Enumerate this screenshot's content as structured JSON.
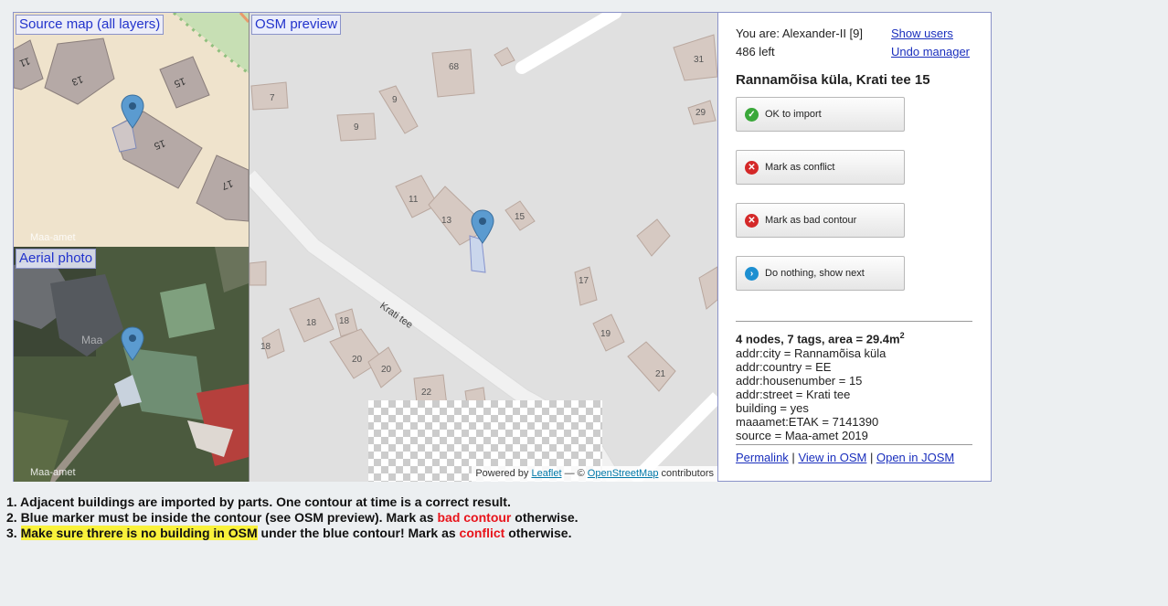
{
  "panes": {
    "source_label": "Source map (all layers)",
    "aerial_label": "Aerial photo",
    "osm_label": "OSM preview",
    "source_credit": "Maa-amet",
    "aerial_credit": "Maa-amet",
    "aerial_watermark": "Maa"
  },
  "source_map": {
    "house_numbers": [
      "11",
      "13",
      "15",
      "15",
      "17"
    ]
  },
  "osm_map": {
    "street_name": "Krati tee",
    "house_numbers": [
      "68",
      "31",
      "7",
      "9",
      "9",
      "29",
      "11",
      "13",
      "15",
      "17",
      "18",
      "18",
      "18",
      "19",
      "20",
      "20",
      "21",
      "22"
    ]
  },
  "attribution": {
    "powered_by": "Powered by",
    "leaflet": "Leaflet",
    "dash": "— ©",
    "osm": "OpenStreetMap",
    "contributors": "contributors"
  },
  "user": {
    "you_are": "You are: Alexander-II [9]",
    "left": "486 left",
    "show_users": "Show users",
    "undo_manager": "Undo manager"
  },
  "address": "Rannamõisa küla, Krati tee 15",
  "buttons": {
    "ok": "OK to import",
    "conflict": "Mark as conflict",
    "bad_contour": "Mark as bad contour",
    "nothing": "Do nothing, show next"
  },
  "summary": {
    "nodes_tags": "4 nodes, 7 tags",
    "area_prefix": ", area = 29.4m",
    "area_sup": "2"
  },
  "tags": [
    "addr:city = Rannamõisa küla",
    "addr:country = EE",
    "addr:housenumber = 15",
    "addr:street = Krati tee",
    "building = yes",
    "maaamet:ETAK = 7141390",
    "source = Maa-amet 2019"
  ],
  "links": {
    "permalink": "Permalink",
    "sep": "|",
    "view_osm": "View in OSM",
    "open_josm": "Open in JOSM"
  },
  "notes": {
    "n1": "1. Adjacent buildings are imported by parts. One contour at time is a correct result.",
    "n2_a": "2. Blue marker must be inside the contour (see OSM preview). Mark as ",
    "n2_red": "bad contour",
    "n2_b": " otherwise.",
    "n3_a": "3. ",
    "n3_hl": "Make sure threre is no building in OSM",
    "n3_b": " under the blue contour! Mark as ",
    "n3_red": "conflict",
    "n3_c": " otherwise."
  },
  "colors": {
    "ok": "#3aa83a",
    "conflict": "#d42828",
    "nothing": "#1d8fd1",
    "link": "#1a2fbd",
    "warn_red": "#e8141b",
    "highlight": "#f9f23b"
  },
  "icons": [
    "check-icon",
    "cross-icon",
    "cross-icon",
    "arrow-right-icon",
    "map-marker-icon"
  ]
}
